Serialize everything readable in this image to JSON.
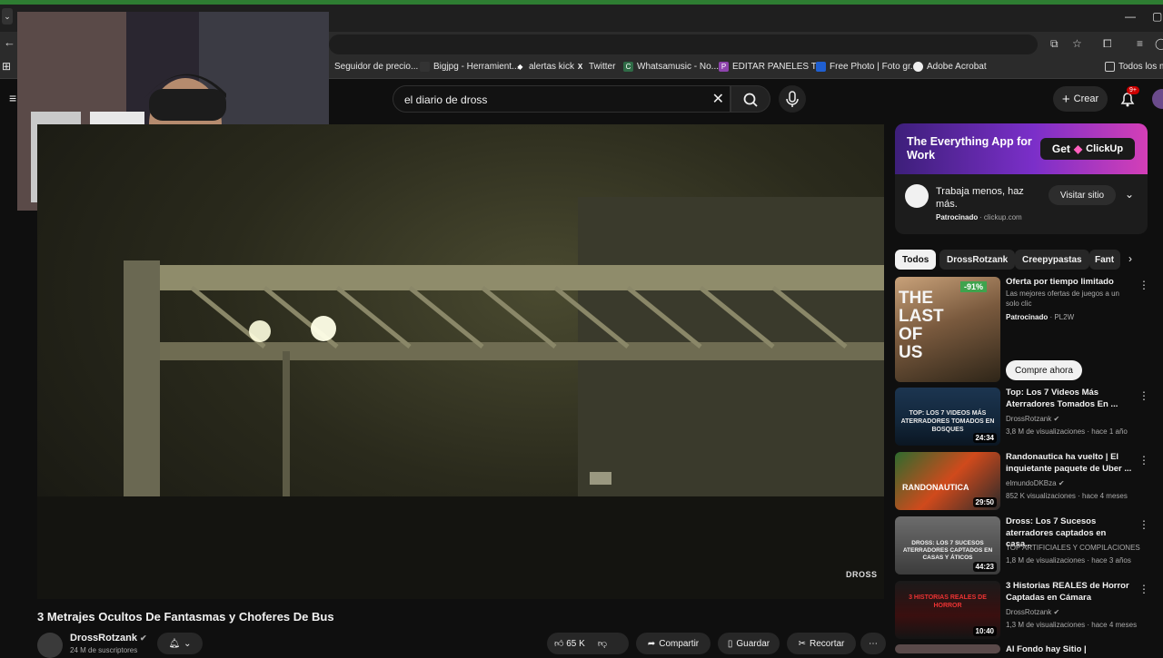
{
  "browser": {
    "bookmarks": [
      {
        "label": "Seguidor de precio...",
        "icon": "page-icon"
      },
      {
        "label": "Bigjpg - Herramient...",
        "icon": "bigjpg-icon"
      },
      {
        "label": "alertas kick",
        "icon": "diamond-icon"
      },
      {
        "label": "Twitter",
        "icon": "x-logo-icon"
      },
      {
        "label": "Whatsamusic - No...",
        "icon": "whatsamusic-icon"
      },
      {
        "label": "EDITAR PANELES T...",
        "icon": "p-icon"
      },
      {
        "label": "Free Photo | Foto gr...",
        "icon": "freepik-icon"
      },
      {
        "label": "Adobe Acrobat",
        "icon": "acrobat-icon"
      }
    ],
    "all_bookmarks": "Todos los m"
  },
  "youtube": {
    "search_query": "el diario de dross",
    "create_label": "Crear",
    "notification_badge": "9+",
    "video": {
      "title": "3 Metrajes Ocultos De Fantasmas y Choferes De Bus",
      "channel": "DrossRotzank",
      "subscribers": "24 M de suscriptores",
      "likes": "65 K",
      "share": "Compartir",
      "save": "Guardar",
      "clip": "Recortar",
      "watermark": "DROSS"
    },
    "ad": {
      "banner_text": "The Everything App for Work",
      "banner_cta": "Get",
      "banner_brand": "ClickUp",
      "headline": "Trabaja menos, haz más.",
      "sponsored": "Patrocinado",
      "domain": "clickup.com",
      "visit": "Visitar sitio"
    },
    "chips": [
      "Todos",
      "DrossRotzank",
      "Creepypastas",
      "Fant"
    ],
    "recommendations": [
      {
        "title": "Oferta por tiempo limitado",
        "subtitle": "Las mejores ofertas de juegos a un solo clic",
        "sponsored": "Patrocinado",
        "source": "PL2W",
        "discount": "-91%",
        "cta": "Compre ahora",
        "thumb_text": "THE LAST OF US"
      },
      {
        "title": "Top: Los 7 Videos Más Aterradores Tomados En ...",
        "channel": "DrossRotzank",
        "meta": "3,8 M de visualizaciones · hace 1 año",
        "duration": "24:34",
        "thumb_text": "TOP: LOS 7 VIDEOS MÁS ATERRADORES TOMADOS EN BOSQUES"
      },
      {
        "title": "Randonautica ha vuelto | El inquietante paquete de Uber ...",
        "channel": "elmundoDKBza",
        "meta": "852 K visualizaciones · hace 4 meses",
        "duration": "29:50",
        "thumb_text": "RANDONAUTICA"
      },
      {
        "title": "Dross: Los 7 Sucesos aterradores captados en casa...",
        "channel": "TOP ARTIFICIALES Y COMPILACIONES",
        "meta": "1,8 M de visualizaciones · hace 3 años",
        "duration": "44:23",
        "thumb_text": "DROSS: LOS 7 SUCESOS ATERRADORES CAPTADOS EN CASAS Y ÁTICOS"
      },
      {
        "title": "3 Historias REALES de Horror Captadas en Cámara",
        "channel": "DrossRotzank",
        "meta": "1,3 M de visualizaciones · hace 4 meses",
        "duration": "10:40",
        "thumb_text": "3 HISTORIAS REALES DE HORROR"
      },
      {
        "title": "Al Fondo hay Sitio | Temporada"
      }
    ]
  }
}
